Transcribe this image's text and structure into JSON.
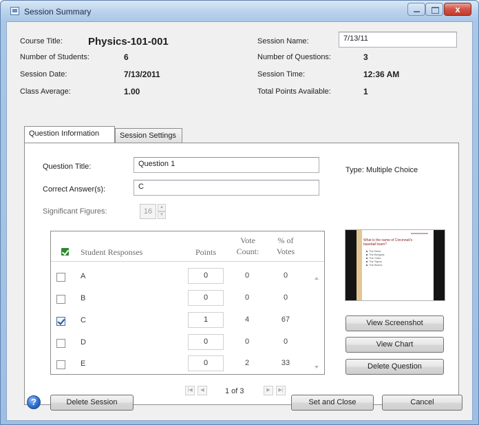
{
  "window": {
    "title": "Session Summary",
    "close_glyph": "x",
    "icon": "session-icon"
  },
  "summary": {
    "course_title_label": "Course Title:",
    "course_title_value": "Physics-101-001",
    "students_label": "Number of Students:",
    "students_value": "6",
    "session_date_label": "Session Date:",
    "session_date_value": "7/13/2011",
    "class_average_label": "Class Average:",
    "class_average_value": "1.00",
    "session_name_label": "Session Name:",
    "session_name_value": "7/13/11",
    "questions_label": "Number of Questions:",
    "questions_value": "3",
    "session_time_label": "Session Time:",
    "session_time_value": "12:36 AM",
    "total_points_label": "Total Points Available:",
    "total_points_value": "1"
  },
  "tabs": [
    {
      "label": "Question Information",
      "active": true
    },
    {
      "label": "Session Settings",
      "active": false
    }
  ],
  "question": {
    "title_label": "Question Title:",
    "title_value": "Question 1",
    "answer_label": "Correct Answer(s):",
    "answer_value": "C",
    "sigfig_label": "Significant Figures:",
    "sigfig_value": "16",
    "type_text": "Type: Multiple Choice"
  },
  "grid": {
    "columns": {
      "responses": "Student Responses",
      "points": "Points",
      "vote_count": "Vote Count:",
      "pct_votes": "% of Votes"
    },
    "rows": [
      {
        "letter": "A",
        "checked": false,
        "points": "0",
        "votes": "0",
        "pct": "0"
      },
      {
        "letter": "B",
        "checked": false,
        "points": "0",
        "votes": "0",
        "pct": "0"
      },
      {
        "letter": "C",
        "checked": true,
        "points": "1",
        "votes": "4",
        "pct": "67"
      },
      {
        "letter": "D",
        "checked": false,
        "points": "0",
        "votes": "0",
        "pct": "0"
      },
      {
        "letter": "E",
        "checked": false,
        "points": "0",
        "votes": "2",
        "pct": "33"
      }
    ]
  },
  "pager": {
    "text": "1 of 3"
  },
  "preview": {
    "question_text": "What is the name of Cincinnati's baseball team?",
    "bullets": [
      "The Reds",
      "The Bengals",
      "The Cubs",
      "The Tigers",
      "The Bruins"
    ]
  },
  "side_buttons": {
    "view_screenshot": "View Screenshot",
    "view_chart": "View Chart",
    "delete_question": "Delete Question"
  },
  "bottom_buttons": {
    "help": "?",
    "delete_session": "Delete Session",
    "set_and_close": "Set and Close",
    "cancel": "Cancel"
  },
  "colors": {
    "titlebar": "#bcd3ec",
    "close_button": "#c23a2c",
    "checkmark_green": "#2c8a2f",
    "dialog_background": "#f0f0f0"
  }
}
